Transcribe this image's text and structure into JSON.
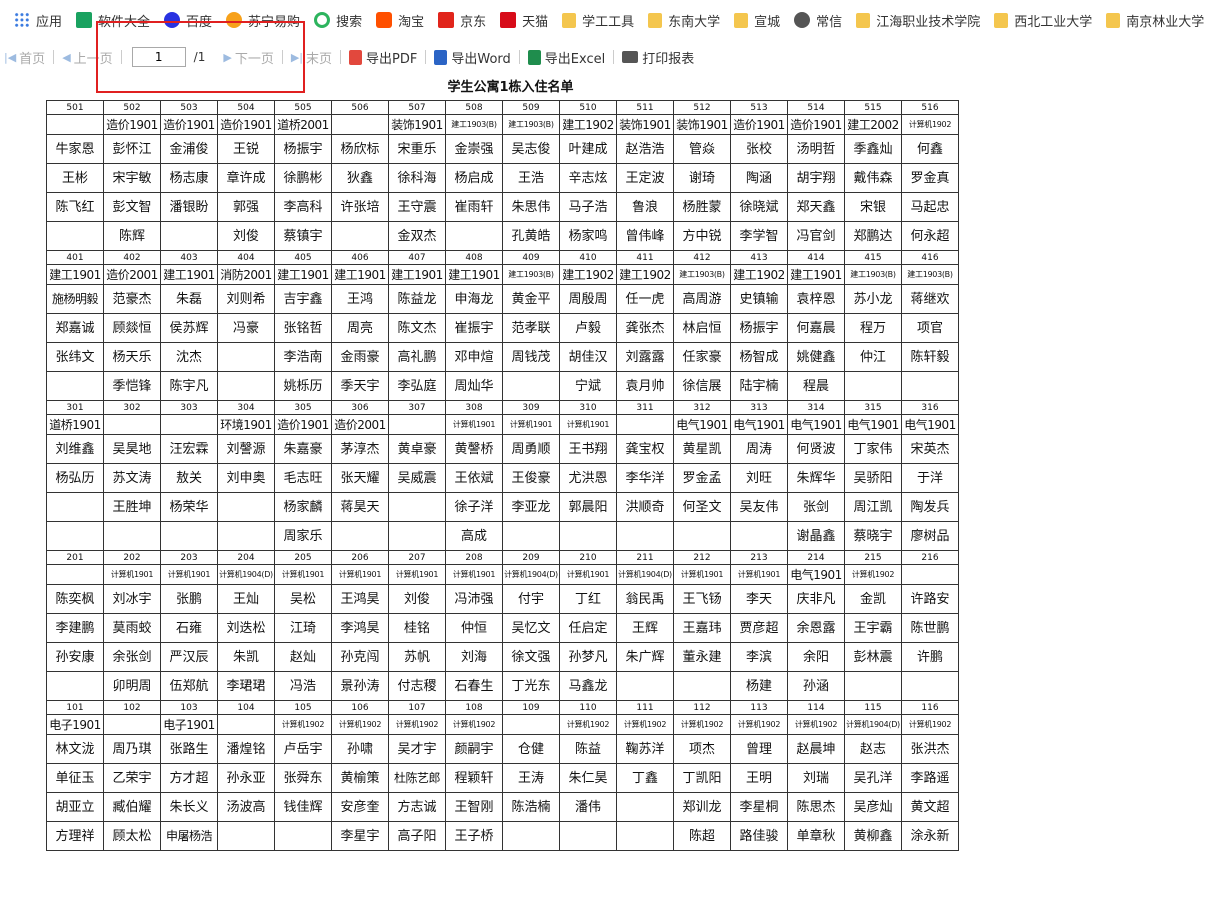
{
  "bookmarks": [
    {
      "label": "应用",
      "icon": "apps-icon"
    },
    {
      "label": "软件大全",
      "icon": "download-icon"
    },
    {
      "label": "百度",
      "icon": "baidu-icon"
    },
    {
      "label": "苏宁易购",
      "icon": "suning-icon"
    },
    {
      "label": "搜索",
      "icon": "search-icon"
    },
    {
      "label": "淘宝",
      "icon": "taobao-icon"
    },
    {
      "label": "京东",
      "icon": "jd-icon"
    },
    {
      "label": "天猫",
      "icon": "tmall-icon"
    },
    {
      "label": "学工工具",
      "icon": "folder-icon"
    },
    {
      "label": "东南大学",
      "icon": "folder-icon"
    },
    {
      "label": "宣城",
      "icon": "folder-icon"
    },
    {
      "label": "常信",
      "icon": "globe-icon"
    },
    {
      "label": "江海职业技术学院",
      "icon": "folder-icon"
    },
    {
      "label": "西北工业大学",
      "icon": "folder-icon"
    },
    {
      "label": "南京林业大学",
      "icon": "folder-icon"
    }
  ],
  "toolbar": {
    "first": "首页",
    "prev": "上一页",
    "page": "1",
    "total": "/1",
    "next": "下一页",
    "last": "末页",
    "pdf": "导出PDF",
    "word": "导出Word",
    "excel": "导出Excel",
    "print": "打印报表"
  },
  "report": {
    "title": "学生公寓1栋入住名单",
    "floors": [
      {
        "rooms": [
          "501",
          "502",
          "503",
          "504",
          "505",
          "506",
          "507",
          "508",
          "509",
          "510",
          "511",
          "512",
          "513",
          "514",
          "515",
          "516"
        ],
        "classes": [
          "",
          "造价1901",
          "造价1901",
          "造价1901",
          "道桥2001",
          "",
          "装饰1901",
          "建工1903(B)",
          "建工1903(B)",
          "建工1902",
          "装饰1901",
          "装饰1901",
          "造价1901",
          "造价1901",
          "建工2002",
          "计算机1902"
        ],
        "names": [
          [
            "牛家恩",
            "彭怀江",
            "金浦俊",
            "王锐",
            "杨振宇",
            "杨欣标",
            "宋重乐",
            "金崇强",
            "吴志俊",
            "叶建成",
            "赵浩浩",
            "管焱",
            "张校",
            "汤明哲",
            "季鑫灿",
            "何鑫"
          ],
          [
            "王彬",
            "宋宇敏",
            "杨志康",
            "章许成",
            "徐鹏彬",
            "狄鑫",
            "徐科海",
            "杨启成",
            "王浩",
            "辛志炫",
            "王定波",
            "谢琦",
            "陶涵",
            "胡宇翔",
            "戴伟森",
            "罗金真"
          ],
          [
            "陈飞红",
            "彭文智",
            "潘银盼",
            "郭强",
            "李高科",
            "许张培",
            "王守震",
            "崔雨轩",
            "朱思伟",
            "马子浩",
            "鲁浪",
            "杨胜蒙",
            "徐晓斌",
            "郑天鑫",
            "宋银",
            "马起忠"
          ],
          [
            "",
            "陈辉",
            "",
            "刘俊",
            "蔡镇宇",
            "",
            "金双杰",
            "",
            "孔黄皓",
            "杨家鸣",
            "曾伟峰",
            "方中锐",
            "李学智",
            "冯官剑",
            "郑鹏达",
            "何永超"
          ]
        ]
      },
      {
        "rooms": [
          "401",
          "402",
          "403",
          "404",
          "405",
          "406",
          "407",
          "408",
          "409",
          "410",
          "411",
          "412",
          "413",
          "414",
          "415",
          "416"
        ],
        "classes": [
          "建工1901",
          "造价2001",
          "建工1901",
          "消防2001",
          "建工1901",
          "建工1901",
          "建工1901",
          "建工1901",
          "建工1903(B)",
          "建工1902",
          "建工1902",
          "建工1903(B)",
          "建工1902",
          "建工1901",
          "建工1903(B)",
          "建工1903(B)"
        ],
        "names": [
          [
            "施杨明毅",
            "范豪杰",
            "朱磊",
            "刘则希",
            "吉宇鑫",
            "王鸿",
            "陈益龙",
            "申海龙",
            "黄金平",
            "周殷周",
            "任一虎",
            "高周游",
            "史镇输",
            "袁梓恩",
            "苏小龙",
            "蒋继欢"
          ],
          [
            "郑嘉诚",
            "顾燚恒",
            "侯苏辉",
            "冯豪",
            "张铭哲",
            "周亮",
            "陈文杰",
            "崔振宇",
            "范孝联",
            "卢毅",
            "龚张杰",
            "林启恒",
            "杨振宇",
            "何嘉晨",
            "程万",
            "项官"
          ],
          [
            "张纬文",
            "杨天乐",
            "沈杰",
            "",
            "李浩南",
            "金雨豪",
            "高礼鹏",
            "邓申煊",
            "周钱茂",
            "胡佳汉",
            "刘露露",
            "任家豪",
            "杨智成",
            "姚健鑫",
            "仲江",
            "陈轩毅"
          ],
          [
            "",
            "季恺锋",
            "陈宇凡",
            "",
            "姚栎历",
            "季天宇",
            "李弘庭",
            "周灿华",
            "",
            "宁斌",
            "袁月帅",
            "徐信展",
            "陆宇楠",
            "程晨",
            "",
            ""
          ]
        ]
      },
      {
        "rooms": [
          "301",
          "302",
          "303",
          "304",
          "305",
          "306",
          "307",
          "308",
          "309",
          "310",
          "311",
          "312",
          "313",
          "314",
          "315",
          "316"
        ],
        "classes": [
          "道桥1901",
          "",
          "",
          "环境1901",
          "造价1901",
          "造价2001",
          "",
          "计算机1901",
          "计算机1901",
          "计算机1901",
          "",
          "电气1901",
          "电气1901",
          "电气1901",
          "电气1901",
          "电气1901"
        ],
        "names": [
          [
            "刘维鑫",
            "吴昊地",
            "汪宏霖",
            "刘謦源",
            "朱嘉豪",
            "茅淳杰",
            "黄卓豪",
            "黄謦桥",
            "周勇顺",
            "王书翔",
            "龚宝权",
            "黄星凯",
            "周涛",
            "何贤波",
            "丁家伟",
            "宋英杰"
          ],
          [
            "杨弘历",
            "苏文涛",
            "敖关",
            "刘申奥",
            "毛志旺",
            "张天耀",
            "吴威震",
            "王依斌",
            "王俊豪",
            "尤洪恩",
            "李华洋",
            "罗金孟",
            "刘旺",
            "朱辉华",
            "吴骄阳",
            "于洋"
          ],
          [
            "",
            "王胜坤",
            "杨荣华",
            "",
            "杨家麟",
            "蒋昊天",
            "",
            "徐子洋",
            "李亚龙",
            "郭晨阳",
            "洪顺奇",
            "何圣文",
            "吴友伟",
            "张剑",
            "周江凯",
            "陶发兵"
          ],
          [
            "",
            "",
            "",
            "",
            "周家乐",
            "",
            "",
            "高成",
            "",
            "",
            "",
            "",
            "",
            "谢晶鑫",
            "蔡晓宇",
            "廖树品"
          ]
        ]
      },
      {
        "rooms": [
          "201",
          "202",
          "203",
          "204",
          "205",
          "206",
          "207",
          "208",
          "209",
          "210",
          "211",
          "212",
          "213",
          "214",
          "215",
          "216"
        ],
        "classes": [
          "",
          "计算机1901",
          "计算机1901",
          "计算机1904(D)",
          "计算机1901",
          "计算机1901",
          "计算机1901",
          "计算机1901",
          "计算机1904(D)",
          "计算机1901",
          "计算机1904(D)",
          "计算机1901",
          "计算机1901",
          "电气1901",
          "计算机1902",
          ""
        ],
        "names": [
          [
            "陈奕枫",
            "刘冰宇",
            "张鹏",
            "王灿",
            "吴松",
            "王鸿昊",
            "刘俊",
            "冯沛强",
            "付宇",
            "丁红",
            "翁民禹",
            "王飞钖",
            "李天",
            "庆非凡",
            "金凯",
            "许路安"
          ],
          [
            "李建鹏",
            "莫雨蛟",
            "石雍",
            "刘迭松",
            "江琦",
            "李鸿昊",
            "桂铭",
            "仲恒",
            "吴忆文",
            "任启定",
            "王辉",
            "王嘉玮",
            "贾彦超",
            "余恩露",
            "王宇霸",
            "陈世鹏"
          ],
          [
            "孙安康",
            "余张剑",
            "严汉辰",
            "朱凯",
            "赵灿",
            "孙克闯",
            "苏帆",
            "刘海",
            "徐文强",
            "孙梦凡",
            "朱广辉",
            "董永建",
            "李滨",
            "余阳",
            "彭林震",
            "许鹏"
          ],
          [
            "",
            "卯明周",
            "伍郑航",
            "李珺珺",
            "冯浩",
            "景孙涛",
            "付志稷",
            "石春生",
            "丁光东",
            "马鑫龙",
            "",
            "",
            "杨建",
            "孙涵",
            "",
            ""
          ]
        ]
      },
      {
        "rooms": [
          "101",
          "102",
          "103",
          "104",
          "105",
          "106",
          "107",
          "108",
          "109",
          "110",
          "111",
          "112",
          "113",
          "114",
          "115",
          "116"
        ],
        "classes": [
          "电子1901",
          "",
          "电子1901",
          "",
          "计算机1902",
          "计算机1902",
          "计算机1902",
          "计算机1902",
          "",
          "计算机1902",
          "计算机1902",
          "计算机1902",
          "计算机1902",
          "计算机1902",
          "计算机1904(D)",
          "计算机1902"
        ],
        "names": [
          [
            "林文泷",
            "周乃琪",
            "张路生",
            "潘煌铭",
            "卢岳宇",
            "孙啸",
            "吴才宇",
            "颜嗣宇",
            "仓健",
            "陈益",
            "鞠苏洋",
            "项杰",
            "曾理",
            "赵晨坤",
            "赵志",
            "张洪杰"
          ],
          [
            "单征玉",
            "乙荣宇",
            "方才超",
            "孙永亚",
            "张舜东",
            "黄榆策",
            "杜陈艺郎",
            "程颖轩",
            "王涛",
            "朱仁昊",
            "丁鑫",
            "丁凯阳",
            "王明",
            "刘瑞",
            "吴孔洋",
            "李路遥"
          ],
          [
            "胡亚立",
            "臧伯耀",
            "朱长义",
            "汤波高",
            "钱佳辉",
            "安彦奎",
            "方志诚",
            "王智刚",
            "陈浩楠",
            "潘伟",
            "",
            "郑训龙",
            "李星桐",
            "陈思杰",
            "吴彦灿",
            "黄文超"
          ],
          [
            "方理祥",
            "顾太松",
            "申屠杨浩",
            "",
            "",
            "李星宇",
            "高子阳",
            "王子桥",
            "",
            "",
            "",
            "陈超",
            "路佳骏",
            "单章秋",
            "黄柳鑫",
            "涂永新"
          ]
        ]
      }
    ]
  }
}
